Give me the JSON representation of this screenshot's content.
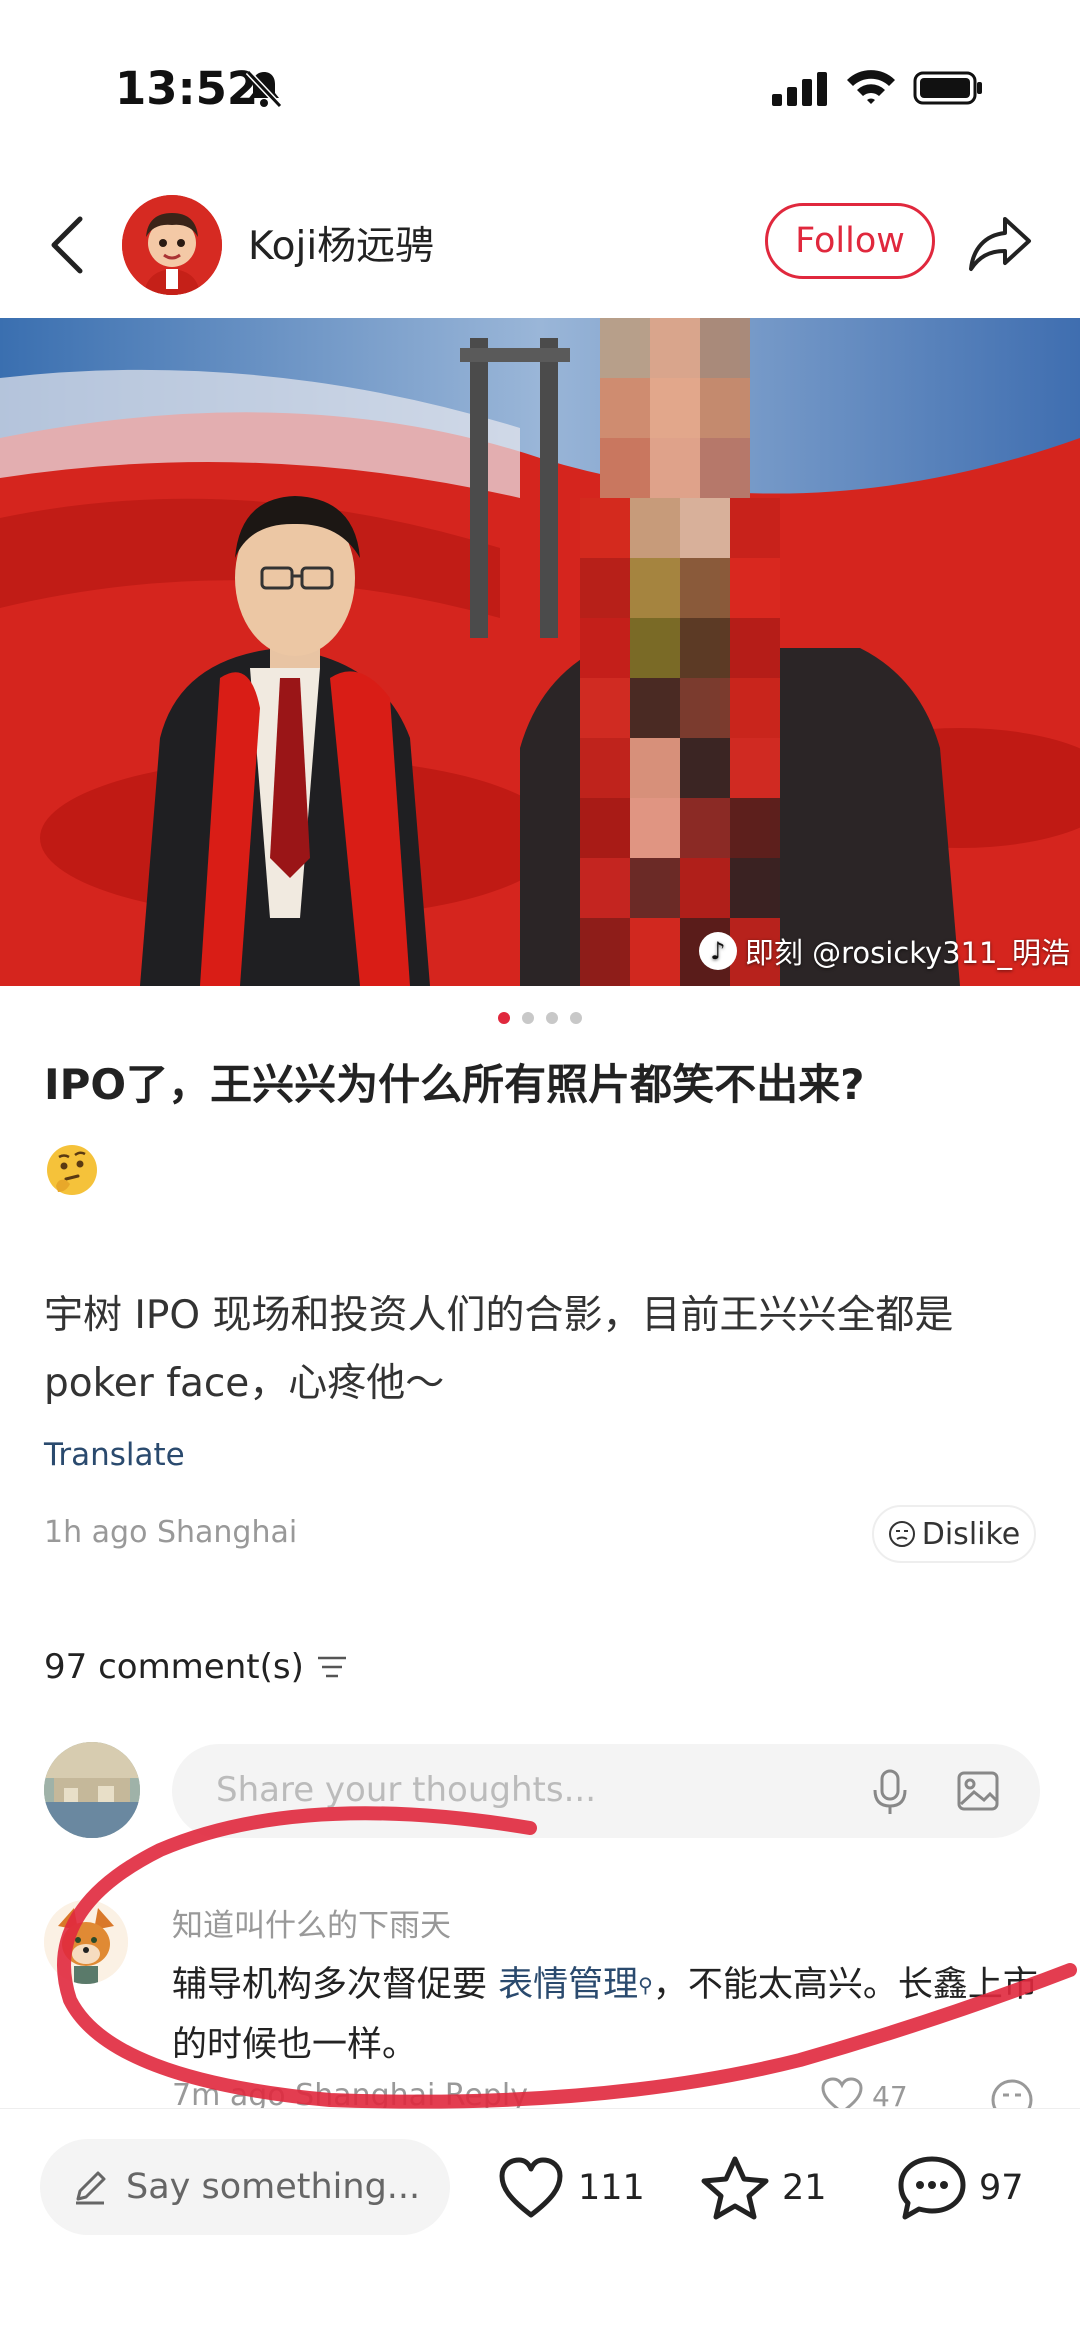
{
  "status_bar": {
    "time": "13:52",
    "icons": [
      "bell-off-icon",
      "signal-icon",
      "wifi-icon",
      "battery-icon"
    ]
  },
  "header": {
    "author_name": "Koji杨远骋",
    "follow_label": "Follow"
  },
  "photo": {
    "watermark_text": "即刻 @rosicky311_明浩",
    "watermark_logo": "♪",
    "page_count": 4,
    "active_page": 1
  },
  "post": {
    "title": "IPO了，王兴兴为什么所有照片都笑不出来?",
    "title_emoji": "thinking-face-icon",
    "body": "宇树 IPO 现场和投资人们的合影，目前王兴兴全都是poker face，心疼他～",
    "translate_label": "Translate",
    "meta": "1h ago Shanghai",
    "dislike_label": "Dislike"
  },
  "comments": {
    "count_label": "97 comment(s)",
    "input_placeholder": "Share your thoughts...",
    "items": [
      {
        "user": "知道叫什么的下雨天",
        "text_before": "辅导机构多次督促要 ",
        "highlight": "表情管理",
        "text_after": "，不能太高兴。长鑫上市的时候也一样。",
        "meta": "7m ago Shanghai  Reply",
        "likes": "47"
      }
    ]
  },
  "bottom_bar": {
    "say_placeholder": "Say something...",
    "likes": "111",
    "stars": "21",
    "comments": "97"
  },
  "colors": {
    "accent": "#e0283d",
    "link": "#2a4a6e",
    "annotation_stroke": "#e0283d"
  }
}
